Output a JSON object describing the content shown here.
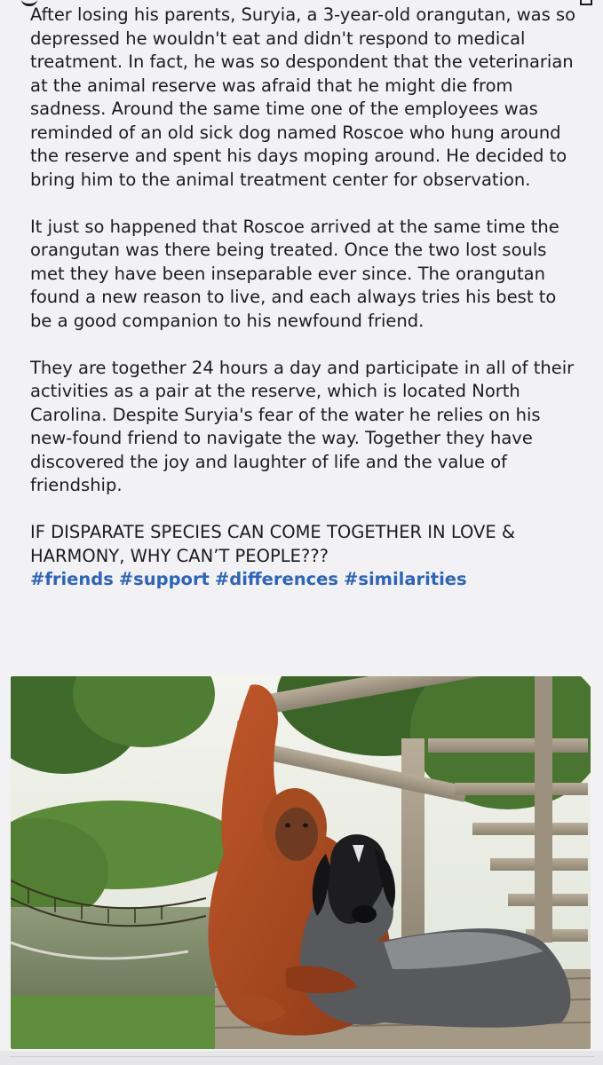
{
  "post": {
    "paragraphs": [
      "After losing his parents, Suryia, a 3-year-old orangutan, was so depressed he wouldn't eat and didn't respond to medical treatment. In fact, he was so despondent that the veterinarian at the animal reserve was afraid that he might die from sadness. Around the same time one of the employees was reminded of an old sick dog named Roscoe who hung around the reserve and spent his days moping around. He decided to bring him to the animal treatment center for observation.",
      "It just so happened that Roscoe arrived at the same time the orangutan was there being treated. Once the two lost souls met they have been inseparable ever since. The orangutan found a new reason to live, and each always tries his best to be a good companion to his newfound friend.",
      "They are together 24 hours a day and participate in all of their activities as a pair at the reserve, which is located North Carolina. Despite Suryia's fear of the water he relies on his new-found friend to navigate the way. Together they have discovered the joy and laughter of life and the value of friendship.",
      "IF DISPARATE SPECIES CAN COME TOGETHER IN LOVE & HARMONY, WHY CAN’T PEOPLE???"
    ],
    "hashtags": [
      "#friends",
      "#support",
      "#differences",
      "#similarities"
    ],
    "link_color": "#2d64bc"
  },
  "photo": {
    "subject": "orangutan sitting with hound dog on wooden deck near stairs, rope bridge and pond in background"
  }
}
